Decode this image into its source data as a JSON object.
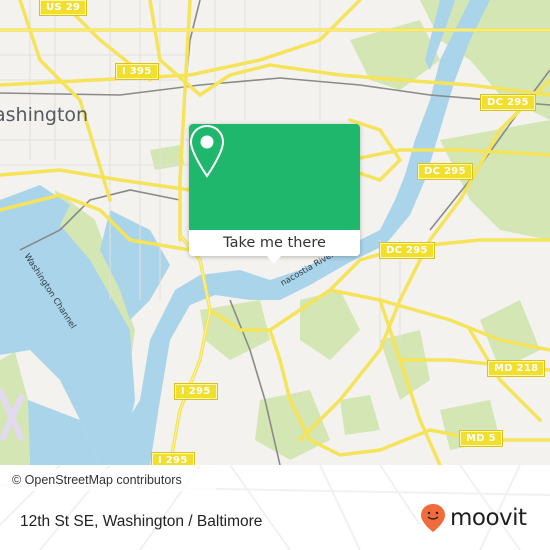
{
  "map": {
    "city_label": "ashington",
    "water_labels": {
      "washington_channel": "Washington Channel",
      "anacostia_river": "nacostia River"
    },
    "road_shields": [
      {
        "id": "us-29",
        "label": "US 29"
      },
      {
        "id": "i-395",
        "label": "I 395"
      },
      {
        "id": "dc-295-north",
        "label": "DC 295"
      },
      {
        "id": "dc-295-middle",
        "label": "DC 295"
      },
      {
        "id": "dc-295-east",
        "label": "DC 295"
      },
      {
        "id": "i-295-upper",
        "label": "I 295"
      },
      {
        "id": "i-295-lower",
        "label": "I 295"
      },
      {
        "id": "md-218",
        "label": "MD 218"
      },
      {
        "id": "md-5",
        "label": "MD 5"
      }
    ],
    "attribution": "© OpenStreetMap contributors",
    "colors": {
      "land": "#f3f2ee",
      "water": "#a9d4ea",
      "park": "#d3e6b4",
      "road": "#f5e35a",
      "rail": "#8a8a8a",
      "shield": "#f2de2c"
    }
  },
  "popup": {
    "icon": "map-pin-icon",
    "button_label": "Take me there",
    "color": "#1fb76b"
  },
  "footer": {
    "address": "12th St SE, Washington / Baltimore",
    "brand": {
      "icon": "moovit-smiley-pin-icon",
      "name": "moovit",
      "color": "#f26b3a"
    }
  }
}
